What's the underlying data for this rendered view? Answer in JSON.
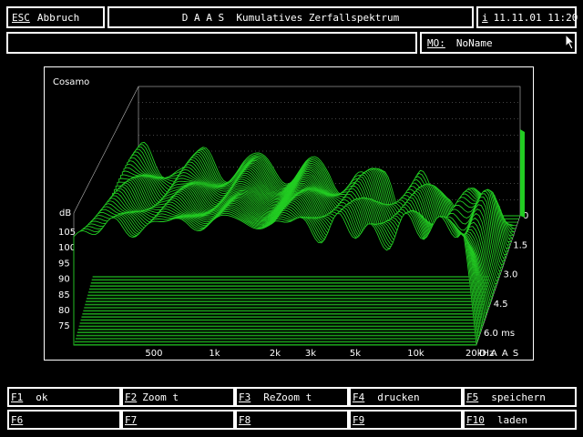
{
  "titlebar": {
    "esc_key": "ESC",
    "abort_label": "Abbruch",
    "title": "D A A S  Kumulatives Zerfallspektrum",
    "info_key": "i",
    "datetime": "11.11.01 11:20"
  },
  "infobar": {
    "field_value": "",
    "mo_label": "MO:",
    "mo_value": "NoName"
  },
  "chart_data": {
    "type": "waterfall",
    "title": "Cosamo",
    "z_unit": "dB",
    "z_ticks": [
      "105",
      "100",
      "95",
      "90",
      "85",
      "80",
      "75"
    ],
    "x_ticks": [
      "500",
      "1k",
      "2k",
      "3k",
      "5k",
      "10k",
      "20kHz"
    ],
    "x_values_hz": [
      500,
      1000,
      2000,
      3000,
      5000,
      10000,
      20000
    ],
    "x_scale": "log",
    "x_range_hz": [
      200,
      20000
    ],
    "time_ticks": [
      "0",
      "1.5",
      "3.0",
      "4.5",
      "6.0 ms"
    ],
    "time_values_ms": [
      0,
      1.5,
      3.0,
      4.5,
      6.0
    ],
    "brand": "D A A S",
    "line_color": "#22cc22",
    "base_color": "#1a991a"
  },
  "function_keys": [
    {
      "key": "F1",
      "label": "ok"
    },
    {
      "key": "F2",
      "label": "Zoom t"
    },
    {
      "key": "F3",
      "label": "ReZoom t"
    },
    {
      "key": "F4",
      "label": "drucken"
    },
    {
      "key": "F5",
      "label": "speichern"
    },
    {
      "key": "F6",
      "label": ""
    },
    {
      "key": "F7",
      "label": ""
    },
    {
      "key": "F8",
      "label": ""
    },
    {
      "key": "F9",
      "label": ""
    },
    {
      "key": "F10",
      "label": "laden"
    }
  ]
}
